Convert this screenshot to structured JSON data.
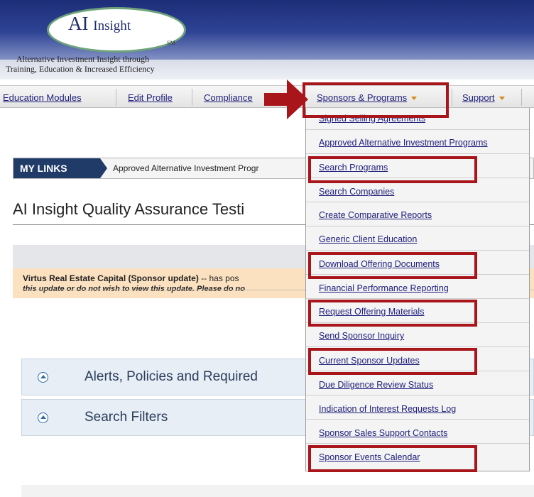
{
  "header": {
    "logo_title": "AI",
    "logo_title_small": "Insight",
    "logo_mark": "SM",
    "tagline_line1": "Alternative Investment Insight through",
    "tagline_line2": "Training, Education & Increased Efficiency"
  },
  "nav": {
    "items": [
      {
        "label": "Education Modules"
      },
      {
        "label": "Edit Profile"
      },
      {
        "label": "Compliance"
      },
      {
        "label": "Sponsors & Programs"
      },
      {
        "label": "Support"
      }
    ]
  },
  "dropdown": {
    "items": [
      {
        "label": "Signed Selling Agreements",
        "highlighted": false
      },
      {
        "label": "Approved Alternative Investment Programs",
        "highlighted": false
      },
      {
        "label": "Search Programs",
        "highlighted": true
      },
      {
        "label": "Search Companies",
        "highlighted": false
      },
      {
        "label": "Create Comparative Reports",
        "highlighted": false
      },
      {
        "label": "Generic Client Education",
        "highlighted": false
      },
      {
        "label": "Download Offering Documents",
        "highlighted": true
      },
      {
        "label": "Financial Performance Reporting",
        "highlighted": false
      },
      {
        "label": "Request Offering Materials",
        "highlighted": true
      },
      {
        "label": "Send Sponsor Inquiry",
        "highlighted": false
      },
      {
        "label": "Current Sponsor Updates",
        "highlighted": true
      },
      {
        "label": "Due Diligence Review Status",
        "highlighted": false
      },
      {
        "label": "Indication of Interest Requests Log",
        "highlighted": false
      },
      {
        "label": "Sponsor Sales Support Contacts",
        "highlighted": false
      },
      {
        "label": "Sponsor Events Calendar",
        "highlighted": true
      }
    ]
  },
  "my_links": {
    "tab": "MY LINKS",
    "item": "Approved Alternative Investment Progr"
  },
  "page_title": "AI Insight Quality Assurance Testi",
  "notice": {
    "sponsor": "Virtus Real Estate Capital (Sponsor update)",
    "text": " -- has pos",
    "line2": "this update or do not wish to view this update. Please do no"
  },
  "accordions": [
    {
      "label": "Alerts, Policies and Required"
    },
    {
      "label": "Search Filters"
    }
  ],
  "colors": {
    "highlight": "#a8151b",
    "link": "#1d1d7a",
    "header_dark": "#1d2d78",
    "notice_bg": "#fbe1c0"
  },
  "icons": {
    "accordion_toggle": "collapse-up-circle-icon",
    "nav_caret": "caret-down-icon",
    "callout": "arrow-right-icon"
  }
}
